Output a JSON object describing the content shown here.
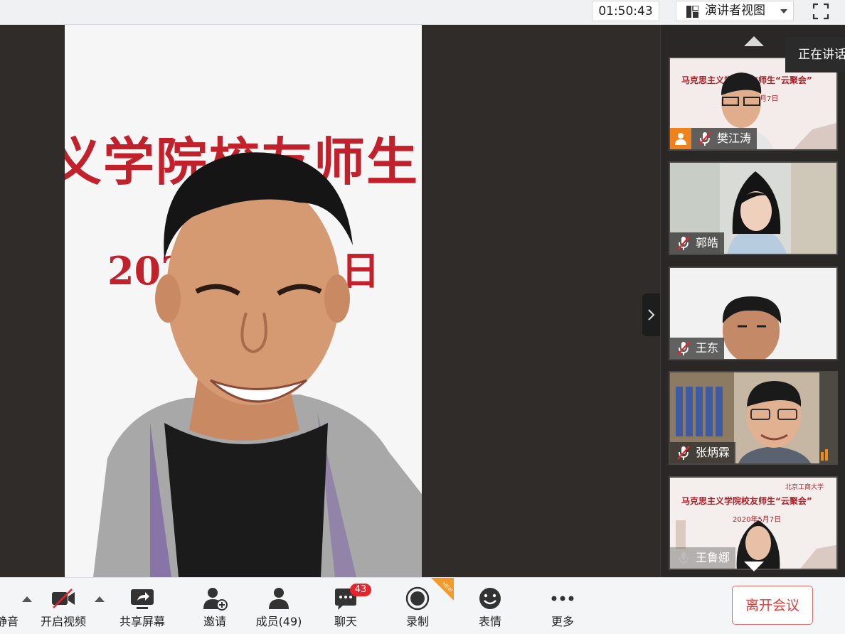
{
  "topbar": {
    "timer": "01:50:43",
    "view_mode": "演讲者视图",
    "fullscreen_icon": "fullscreen-icon"
  },
  "main_video": {
    "banner_line1": "义学院校友师生",
    "banner_line2": "202　　　　日"
  },
  "side_panel": {
    "speaking_tip": "正在讲话",
    "participants": [
      {
        "name": "樊江涛",
        "muted": true,
        "host": true,
        "slide_title": "马克思主义学院校友师生“云聚会”",
        "slide_sub": "月7日"
      },
      {
        "name": "郭皓",
        "muted": true,
        "host": false
      },
      {
        "name": "王东",
        "muted": true,
        "host": false
      },
      {
        "name": "张炳霖",
        "muted": true,
        "host": false
      },
      {
        "name": "王鲁娜",
        "muted": false,
        "host": false,
        "slide_title": "马克思主义学院校友师生“云聚会”",
        "slide_sub": "2020年5月7日",
        "logo_text": "北京工商大学"
      }
    ]
  },
  "toolbar": {
    "mute_label": "静音",
    "video_label": "开启视频",
    "share_label": "共享屏幕",
    "invite_label": "邀请",
    "members_label": "成员(49)",
    "chat_label": "聊天",
    "chat_badge": "43",
    "record_label": "录制",
    "record_new_tag": "NEW",
    "reactions_label": "表情",
    "more_label": "更多",
    "leave_label": "离开会议"
  },
  "colors": {
    "stage_bg": "#2f2c2a",
    "banner_red": "#c2202a",
    "leave_red": "#d9403e",
    "badge_red": "#e5242b",
    "host_orange": "#f0821e"
  }
}
